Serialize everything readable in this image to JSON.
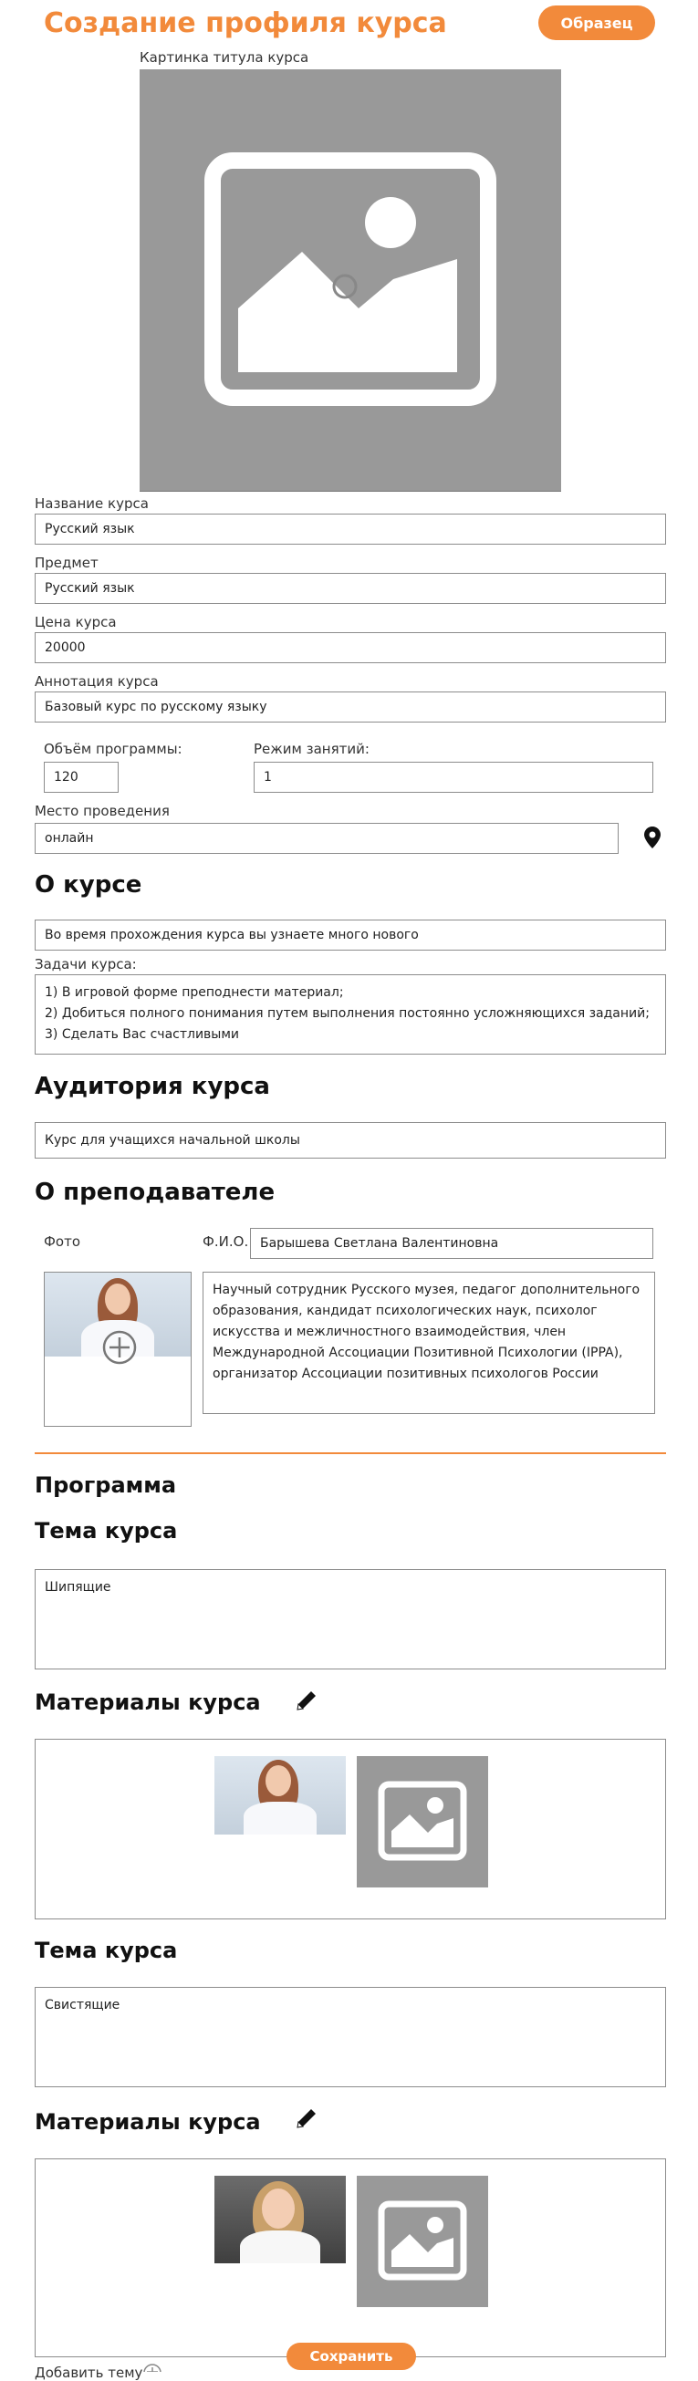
{
  "header": {
    "title": "Создание профиля курса",
    "sample_button": "Образец"
  },
  "cover": {
    "label": "Картинка титула курса",
    "icon": "image-placeholder-icon"
  },
  "fields": {
    "name": {
      "label": "Название курса",
      "value": "Русский язык"
    },
    "subject": {
      "label": "Предмет",
      "value": "Русский язык"
    },
    "price": {
      "label": "Цена курса",
      "value": "20000"
    },
    "annotation": {
      "label": "Аннотация курса",
      "value": "Базовый курс по русскому языку"
    },
    "volume": {
      "label": "Объём программы:",
      "value": "120"
    },
    "mode": {
      "label": "Режим занятий:",
      "value": "1"
    },
    "place": {
      "label": "Место проведения",
      "value": "онлайн",
      "icon": "location-pin-icon"
    }
  },
  "about": {
    "heading": "О курсе",
    "text": "Во время прохождения курса вы узнаете много нового",
    "tasks_label": "Задачи курса:",
    "tasks": [
      "1) В игровой форме преподнести материал;",
      "2) Добиться полного понимания путем выполнения постоянно усложняющихся заданий;",
      "3) Сделать Вас счастливыми"
    ]
  },
  "audience": {
    "heading": "Аудитория курса",
    "text": "Курс для учащихся начальной школы"
  },
  "teacher": {
    "heading": "О преподавателе",
    "photo_label": "Фото",
    "fio_label": "Ф.И.О.",
    "fio_value": "Барышева Светлана Валентиновна",
    "bio": "Научный сотрудник Русского музея, педагог дополнительного образования, кандидат психологических наук, психолог искусства и межличностного взаимодействия, член Международной Ассоциации Позитивной Психологии (IPPA), организатор Ассоциации позитивных психологов России",
    "add_icon": "plus-circle-icon"
  },
  "program": {
    "heading": "Программа",
    "topics": [
      {
        "heading": "Тема курса",
        "text": "Шипящие",
        "materials_heading": "Материалы курса",
        "edit_icon": "pencil-icon"
      },
      {
        "heading": "Тема курса",
        "text": "Свистящие",
        "materials_heading": "Материалы курса",
        "edit_icon": "pencil-icon"
      }
    ],
    "add_topic": "Добавить тему",
    "add_topic_icon": "plus-circle-icon"
  },
  "footer": {
    "save_button": "Сохранить"
  },
  "colors": {
    "accent": "#f28a3b",
    "placeholder_gray": "#999999"
  }
}
